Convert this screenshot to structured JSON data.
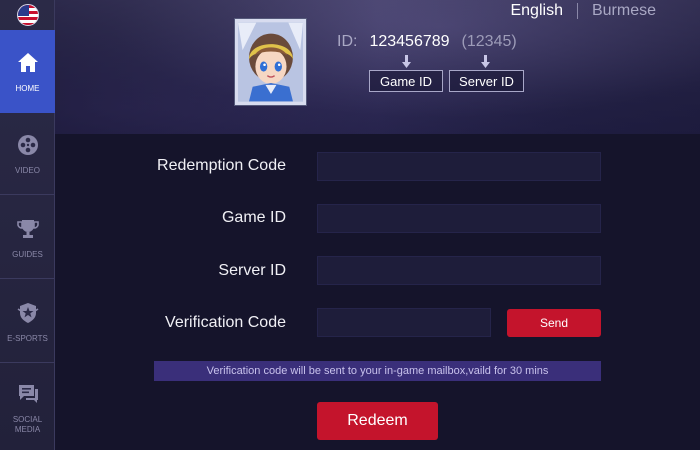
{
  "sidebar": {
    "flag_icon": "us-flag-icon",
    "items": [
      {
        "label": "HOME",
        "icon": "home-icon",
        "active": true
      },
      {
        "label": "VIDEO",
        "icon": "film-reel-icon",
        "active": false
      },
      {
        "label": "GUIDES",
        "icon": "trophy-icon",
        "active": false
      },
      {
        "label": "E-SPORTS",
        "icon": "esports-shield-icon",
        "active": false
      },
      {
        "label": "SOCIAL MEDIA",
        "icon": "chat-bubble-icon",
        "active": false
      }
    ]
  },
  "header": {
    "languages": [
      "English",
      "Burmese"
    ],
    "active_language": "English",
    "avatar_icon": "hero-avatar",
    "id_label": "ID:",
    "game_id_value": "123456789",
    "server_id_value": "(12345)",
    "game_id_hint": "Game ID",
    "server_id_hint": "Server ID"
  },
  "form": {
    "redemption_code_label": "Redemption Code",
    "game_id_label": "Game ID",
    "server_id_label": "Server ID",
    "verification_code_label": "Verification Code",
    "redemption_code_value": "",
    "game_id_value": "",
    "server_id_value": "",
    "verification_code_value": "",
    "send_label": "Send",
    "notice": "Verification code will be sent to your in-game mailbox,vaild for 30 mins",
    "redeem_label": "Redeem"
  },
  "colors": {
    "accent_blue": "#3a53c8",
    "button_red": "#c4142c",
    "page_bg": "#15142b",
    "notice_bg": "#3a2f7a"
  }
}
